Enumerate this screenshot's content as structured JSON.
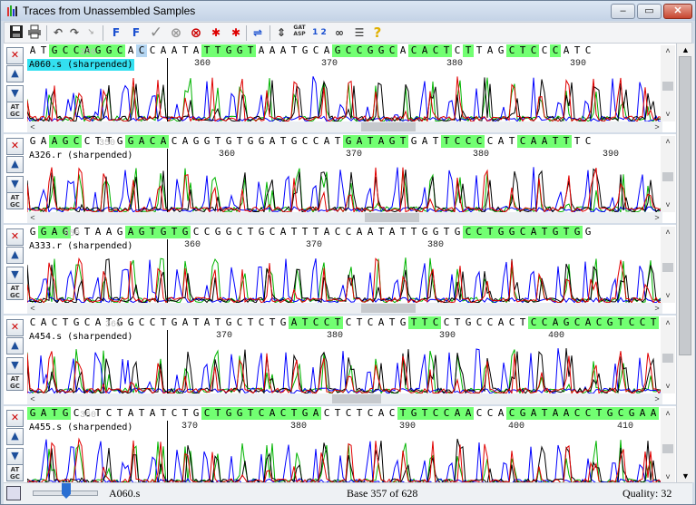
{
  "window": {
    "title": "Traces from Unassembled Samples"
  },
  "window_buttons": {
    "minimize": "–",
    "maximize": "▭",
    "close": "✕"
  },
  "toolbar": {
    "icons": [
      "save-icon",
      "print-icon",
      "undo-icon",
      "redo-icon",
      "redo-disabled-icon",
      "forward-f-icon",
      "reverse-f-icon",
      "accept-check-icon",
      "reject-circle-icon",
      "delete-x-icon",
      "prev-edit-icon",
      "next-edit-icon",
      "strand-arrows-icon",
      "align-icon",
      "translate-icon",
      "numbering-icon",
      "link-icon",
      "options-icon",
      "help-icon"
    ],
    "translate_label": "GAT ASP",
    "numbering_label": "1 2 3",
    "help_label": "?"
  },
  "tracks": [
    {
      "name": "A060.s (sharpended)",
      "selected": true,
      "faded_tick": "350",
      "ticks": [
        "360",
        "370",
        "380",
        "390"
      ],
      "sequence": "ATGCCAGGCACCAATATTGGTAAATGCAGCCGGCACACTCTTAGCTCCCATC",
      "highlight": "0011111110200000111110000000111111011110100011101000"
    },
    {
      "name": "A326.r (sharpended)",
      "selected": false,
      "faded_tick": "350",
      "ticks": [
        "360",
        "370",
        "380",
        "390"
      ],
      "sequence": "GAAGCCTTGGACACAGGTGTGGATGCCATGATAGTGATTCCCCATCAATTTC",
      "highlight": "0011100001111000000000000000011111100011110001111100"
    },
    {
      "name": "A333.r (sharpended)",
      "selected": false,
      "faded_tick": "350",
      "ticks": [
        "360",
        "370",
        "380"
      ],
      "sequence": "GGAGCTAAGAGTGTGCCGGCTGCATTTACCAATATTGGTGCCTGGCATGTGG",
      "highlight": "0111000001111110000000000000000000000000111111111110"
    },
    {
      "name": "A454.s (sharpended)",
      "selected": false,
      "faded_tick": "360",
      "ticks": [
        "370",
        "380",
        "390",
        "400"
      ],
      "sequence": "CACTGCATGGCCTGATATGCTCTGATCCTCTCATGTTCCTGCCACTCCAGCACGTCCT",
      "highlight": "0000000000000000000000001111100000011100000000111111111111"
    },
    {
      "name": "A455.s (sharpended)",
      "selected": false,
      "faded_tick": "360",
      "ticks": [
        "370",
        "380",
        "390",
        "400",
        "410"
      ],
      "sequence": "GATGCCTCTATATCTGCTGGTCACTGACTCTCACTGTCCAACCACGATAACCTGCGAAT",
      "highlight": "1111000000000000111111111110000000111111100011111111111111"
    }
  ],
  "status": {
    "sample": "A060.s",
    "base": "Base 357 of 628",
    "quality": "Quality: 32"
  },
  "base_colors": {
    "A": "#00b400",
    "C": "#0000ff",
    "G": "#000000",
    "T": "#e00000"
  }
}
